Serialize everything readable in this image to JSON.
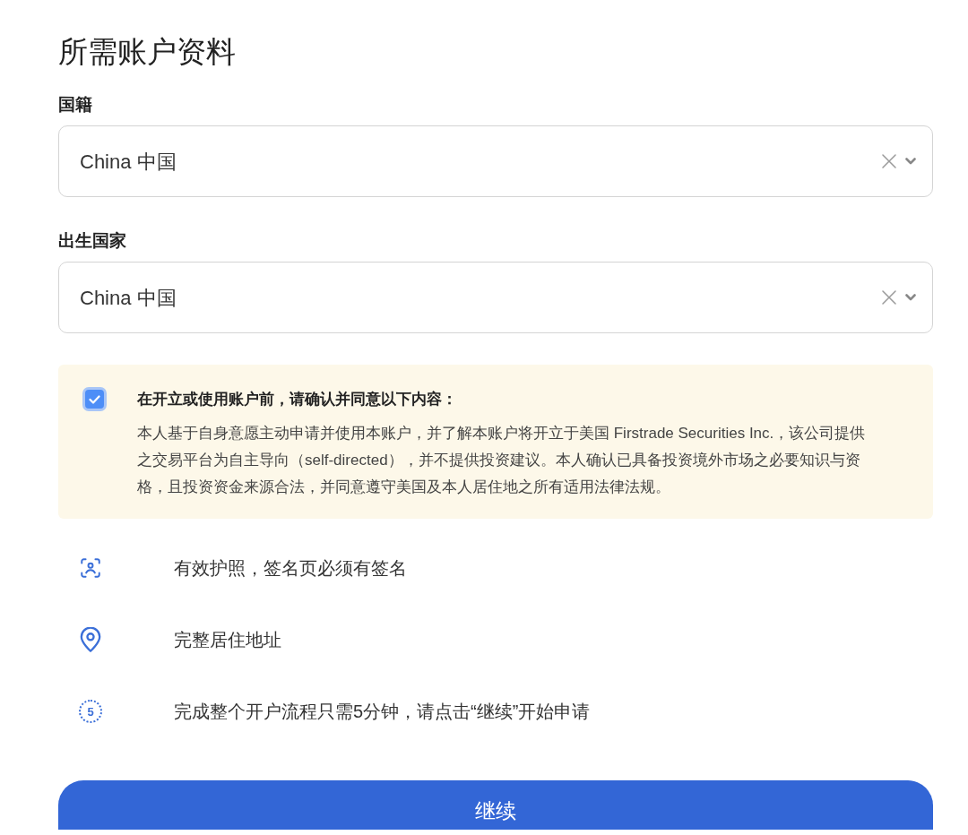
{
  "heading": "所需账户资料",
  "fields": [
    {
      "label": "国籍",
      "value": "China 中国"
    },
    {
      "label": "出生国家",
      "value": "China 中国"
    }
  ],
  "consent": {
    "checked": true,
    "title": "在开立或使用账户前，请确认并同意以下内容：",
    "body": "本人基于自身意愿主动申请并使用本账户，并了解本账户将开立于美国 Firstrade Securities Inc.，该公司提供之交易平台为自主导向（self-directed），并不提供投资建议。本人确认已具备投资境外市场之必要知识与资格，且投资资金来源合法，并同意遵守美国及本人居住地之所有适用法律法规。"
  },
  "requirements": [
    {
      "kind": "face-scan",
      "text": "有效护照，签名页必须有签名"
    },
    {
      "kind": "map-pin",
      "text": "完整居住地址"
    },
    {
      "kind": "timer",
      "icon_text": "5",
      "text": "完成整个开户流程只需5分钟，请点击“继续”开始申请"
    }
  ],
  "button": {
    "label": "继续"
  }
}
